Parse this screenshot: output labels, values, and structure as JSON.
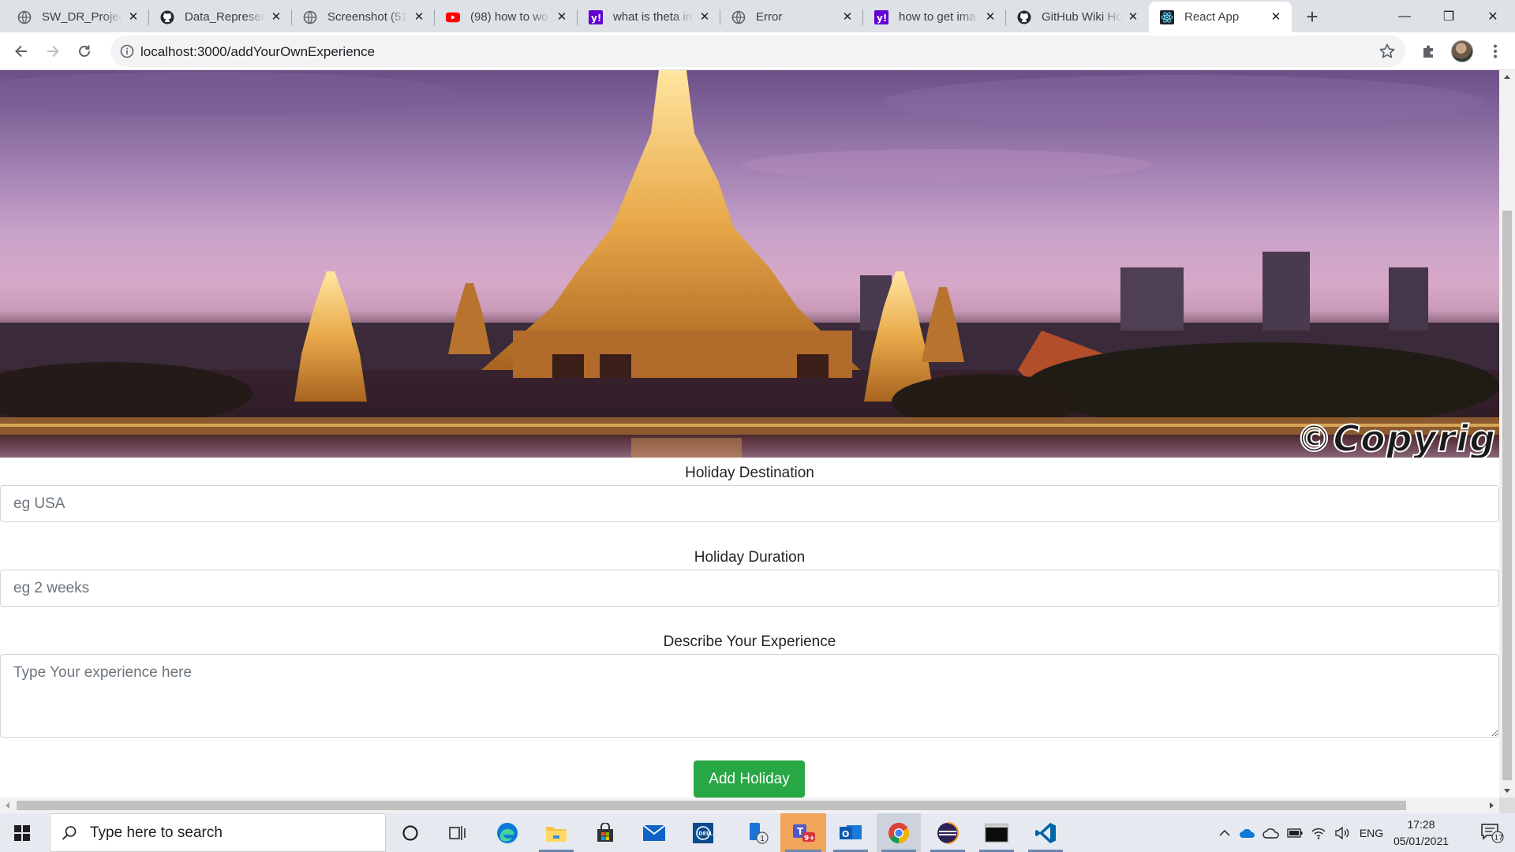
{
  "browser": {
    "tabs": [
      {
        "title": "SW_DR_Project",
        "favicon": "globe-icon"
      },
      {
        "title": "Data_Represen",
        "favicon": "github-icon"
      },
      {
        "title": "Screenshot (51",
        "favicon": "globe-icon"
      },
      {
        "title": "(98) how to wo",
        "favicon": "youtube-icon"
      },
      {
        "title": "what is theta in",
        "favicon": "yahoo-icon"
      },
      {
        "title": "Error",
        "favicon": "globe-icon"
      },
      {
        "title": "how to get ima",
        "favicon": "yahoo-icon"
      },
      {
        "title": "GitHub Wiki Ho",
        "favicon": "github-icon"
      },
      {
        "title": "React App",
        "favicon": "react-icon",
        "active": true
      }
    ],
    "close_glyph": "✕",
    "new_tab_glyph": "+",
    "url": "localhost:3000/addYourOwnExperience",
    "window_controls": {
      "minimize": "—",
      "maximize": "❐",
      "close": "✕"
    }
  },
  "page": {
    "hero_watermark": "©Copyrig",
    "form": {
      "destination": {
        "label": "Holiday Destination",
        "placeholder": "eg USA",
        "value": ""
      },
      "duration": {
        "label": "Holiday Duration",
        "placeholder": "eg 2 weeks",
        "value": ""
      },
      "experience": {
        "label": "Describe Your Experience",
        "placeholder": "Type Your experience here",
        "value": ""
      },
      "submit_label": "Add Holiday"
    }
  },
  "taskbar": {
    "search_placeholder": "Type here to search",
    "apps": [
      "cortana-icon",
      "task-view-icon",
      "edge-icon",
      "file-explorer-icon",
      "store-icon",
      "mail-icon",
      "dell-icon",
      "phone-icon",
      "teams-icon",
      "outlook-icon",
      "chrome-icon",
      "eclipse-icon",
      "terminal-icon",
      "vscode-icon"
    ],
    "teams_badge": "9+",
    "phone_badge": "1",
    "language": "ENG",
    "time": "17:28",
    "date": "05/01/2021",
    "notification_count": "17"
  },
  "colors": {
    "accent_green": "#28a745",
    "tabstrip": "#dee1e6",
    "taskbar": "#e6eaf0"
  }
}
